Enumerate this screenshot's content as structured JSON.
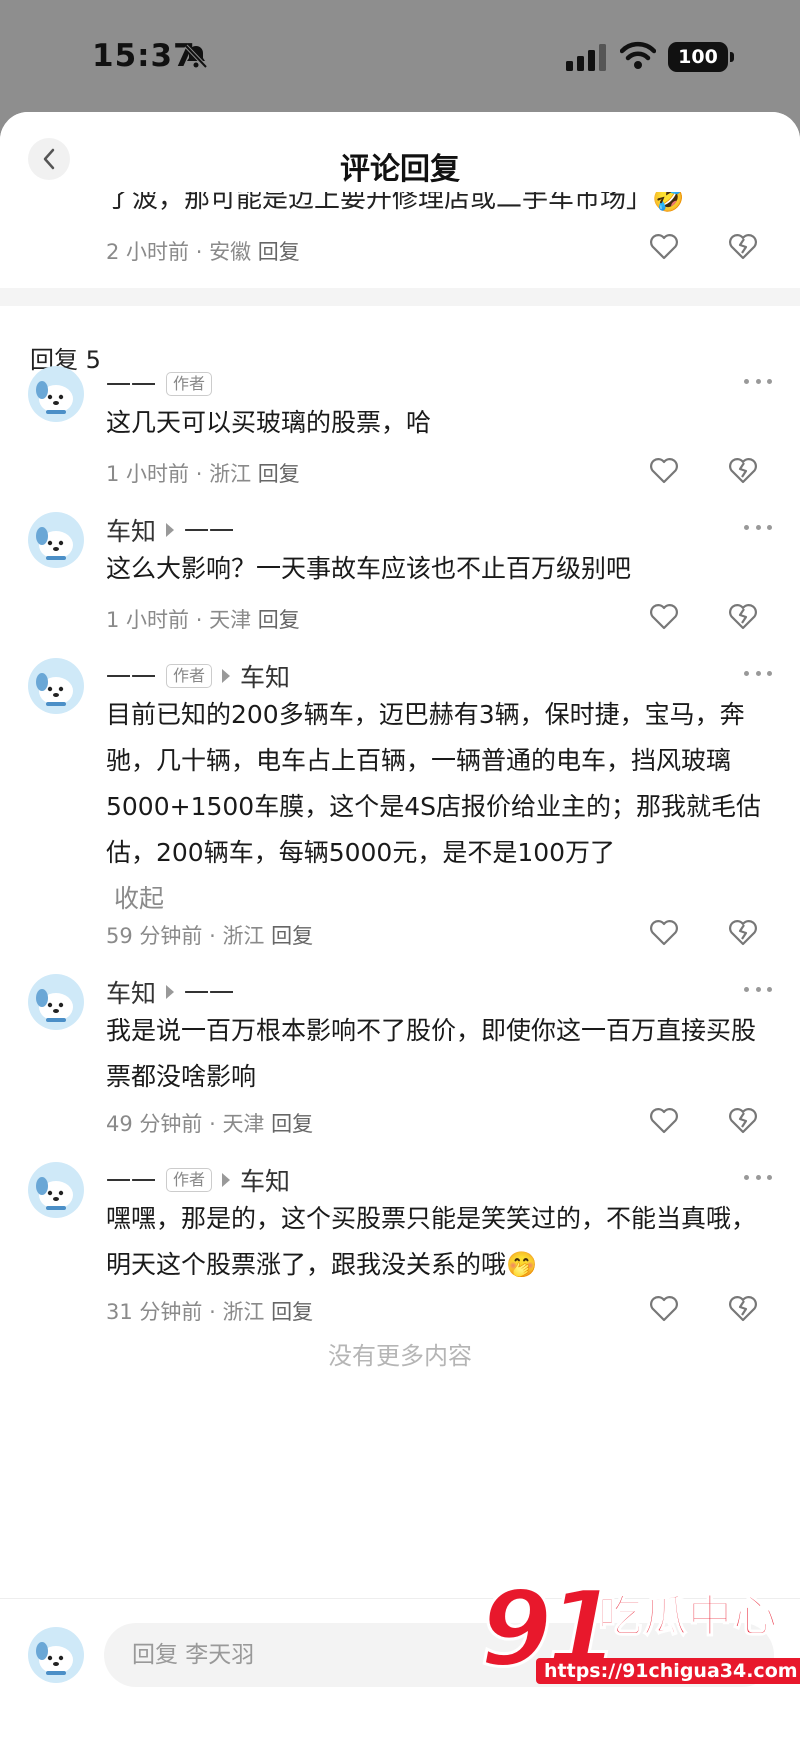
{
  "status_bar": {
    "time": "15:37",
    "battery": "100"
  },
  "header": {
    "title": "评论回复"
  },
  "parent_comment": {
    "partial_text": "了波，那可能是迈上要开修理店或二手车市场」🤣",
    "time": "2 小时前",
    "location": "安徽",
    "reply_label": "回复"
  },
  "replies_count": "回复 5",
  "author_tag": "作者",
  "replies": [
    {
      "user": "一一",
      "is_author": true,
      "to": "",
      "text": "这几天可以买玻璃的股票，哈",
      "time": "1 小时前",
      "location": "浙江",
      "reply_label": "回复"
    },
    {
      "user": "车知",
      "is_author": false,
      "to": "一一",
      "text": "这么大影响？一天事故车应该也不止百万级别吧",
      "time": "1 小时前",
      "location": "天津",
      "reply_label": "回复"
    },
    {
      "user": "一一",
      "is_author": true,
      "to": "车知",
      "text": "目前已知的200多辆车，迈巴赫有3辆，保时捷，宝马，奔驰，几十辆，电车占上百辆，一辆普通的电车，挡风玻璃5000+1500车膜，这个是4S店报价给业主的；那我就毛估估，200辆车，每辆5000元，是不是100万了",
      "collapse": "收起",
      "time": "59 分钟前",
      "location": "浙江",
      "reply_label": "回复"
    },
    {
      "user": "车知",
      "is_author": false,
      "to": "一一",
      "text": "我是说一百万根本影响不了股价，即使你这一百万直接买股票都没啥影响",
      "time": "49 分钟前",
      "location": "天津",
      "reply_label": "回复"
    },
    {
      "user": "一一",
      "is_author": true,
      "to": "车知",
      "text": "嘿嘿，那是的，这个买股票只能是笑笑过的，不能当真哦，明天这个股票涨了，跟我没关系的哦🤭",
      "time": "31 分钟前",
      "location": "浙江",
      "reply_label": "回复"
    }
  ],
  "no_more": "没有更多内容",
  "footer": {
    "input_placeholder": "回复 李天羽"
  },
  "watermark": {
    "number": "91",
    "text": "吃瓜中心",
    "url": "https://91chigua34.com"
  },
  "colors": {
    "accent": "#e8182c",
    "avatar_bg": "#cfe9f8",
    "meta": "#8a8a8a"
  }
}
